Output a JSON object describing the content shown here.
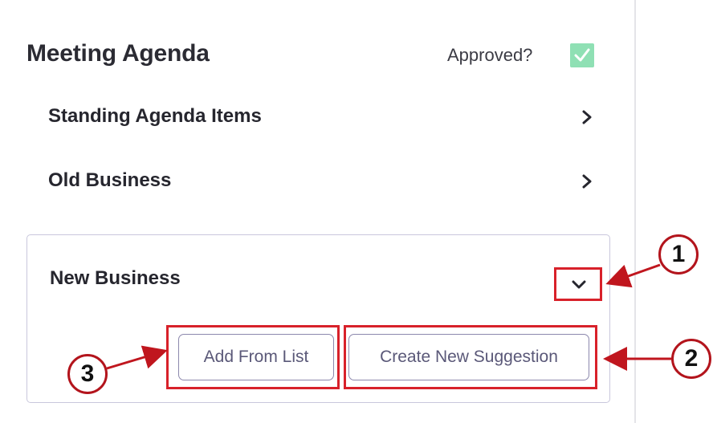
{
  "panel": {
    "title": "Meeting Agenda",
    "approved_label": "Approved?",
    "approved_checked": true,
    "check_color": "#8fe0b4"
  },
  "sections": [
    {
      "label": "Standing Agenda Items",
      "state": "collapsed"
    },
    {
      "label": "Old Business",
      "state": "collapsed"
    }
  ],
  "new_business": {
    "label": "New Business",
    "state": "expanded",
    "add_from_list_label": "Add From List",
    "create_suggestion_label": "Create New Suggestion"
  },
  "annotations": {
    "callout_1": "1",
    "callout_2": "2",
    "callout_3": "3",
    "highlight_color": "#d8212a"
  }
}
